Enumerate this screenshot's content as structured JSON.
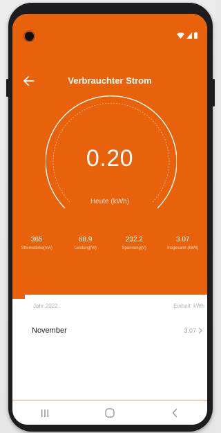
{
  "colors": {
    "accent": "#e8620c",
    "text_on_accent": "#ffffff",
    "muted_text": "#a0a0a0"
  },
  "status_bar": {
    "icons": [
      "wifi-icon",
      "signal-icon",
      "battery-icon"
    ]
  },
  "header": {
    "title": "Verbrauchter Strom",
    "back_icon": "arrow-left-icon"
  },
  "gauge": {
    "value": "0.20",
    "label": "Heute (kWh)"
  },
  "stats": [
    {
      "value": "365",
      "label": "Stromstärke(mA)"
    },
    {
      "value": "68.9",
      "label": "Leistung(W)"
    },
    {
      "value": "232.2",
      "label": "Spannung(V)"
    },
    {
      "value": "3.07",
      "label": "Insgesamt (kWh)"
    }
  ],
  "history": {
    "year_label": "Jahr 2022",
    "unit_label": "Einheit: kWh",
    "rows": [
      {
        "month": "November",
        "value": "3.07"
      }
    ]
  },
  "nav_bar": {
    "buttons": [
      "recent-apps-icon",
      "home-icon",
      "back-icon"
    ]
  }
}
